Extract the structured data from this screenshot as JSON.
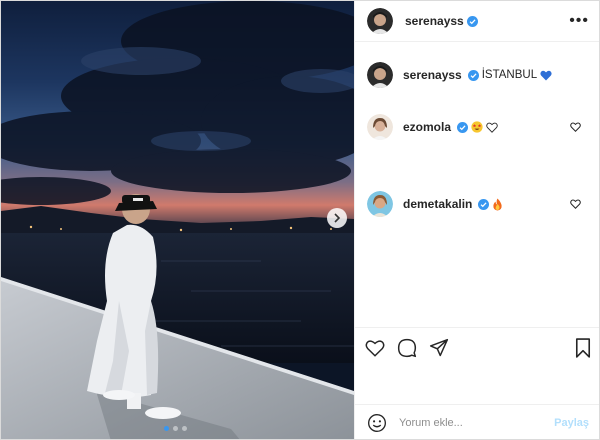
{
  "post": {
    "username": "serenayss",
    "more_label": "•••",
    "caption": {
      "username": "serenayss",
      "text": "İSTANBUL",
      "emoji_icon": "blue-heart-icon"
    },
    "comments": [
      {
        "username": "ezomola",
        "icons": [
          "star-struck-emoji-icon",
          "white-heart-icon"
        ]
      },
      {
        "username": "demetakalin",
        "icons": [
          "fire-emoji-icon"
        ]
      }
    ],
    "carousel": {
      "slides": 3,
      "active": 1
    }
  },
  "add_comment": {
    "placeholder": "Yorum ekle...",
    "post_label": "Paylaş"
  },
  "colors": {
    "verified": "#3897f0",
    "accent_blue": "#3897f0",
    "post_disabled": "#b2dffc",
    "border": "#efefef"
  }
}
